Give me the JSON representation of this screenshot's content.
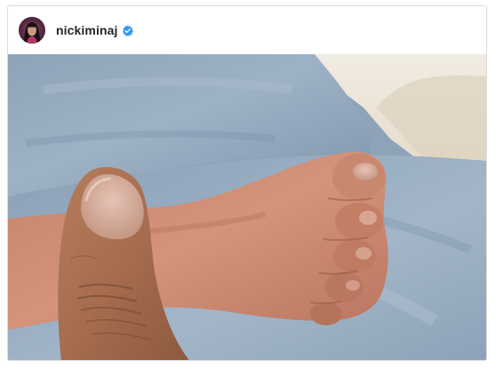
{
  "post": {
    "username": "nickiminaj",
    "verified": true,
    "avatar_icon": "profile-avatar",
    "photo_subject": "baby-foot-photo"
  },
  "colors": {
    "verified_badge": "#3897f0",
    "username_text": "#262626",
    "card_border": "#dbdbdb"
  }
}
